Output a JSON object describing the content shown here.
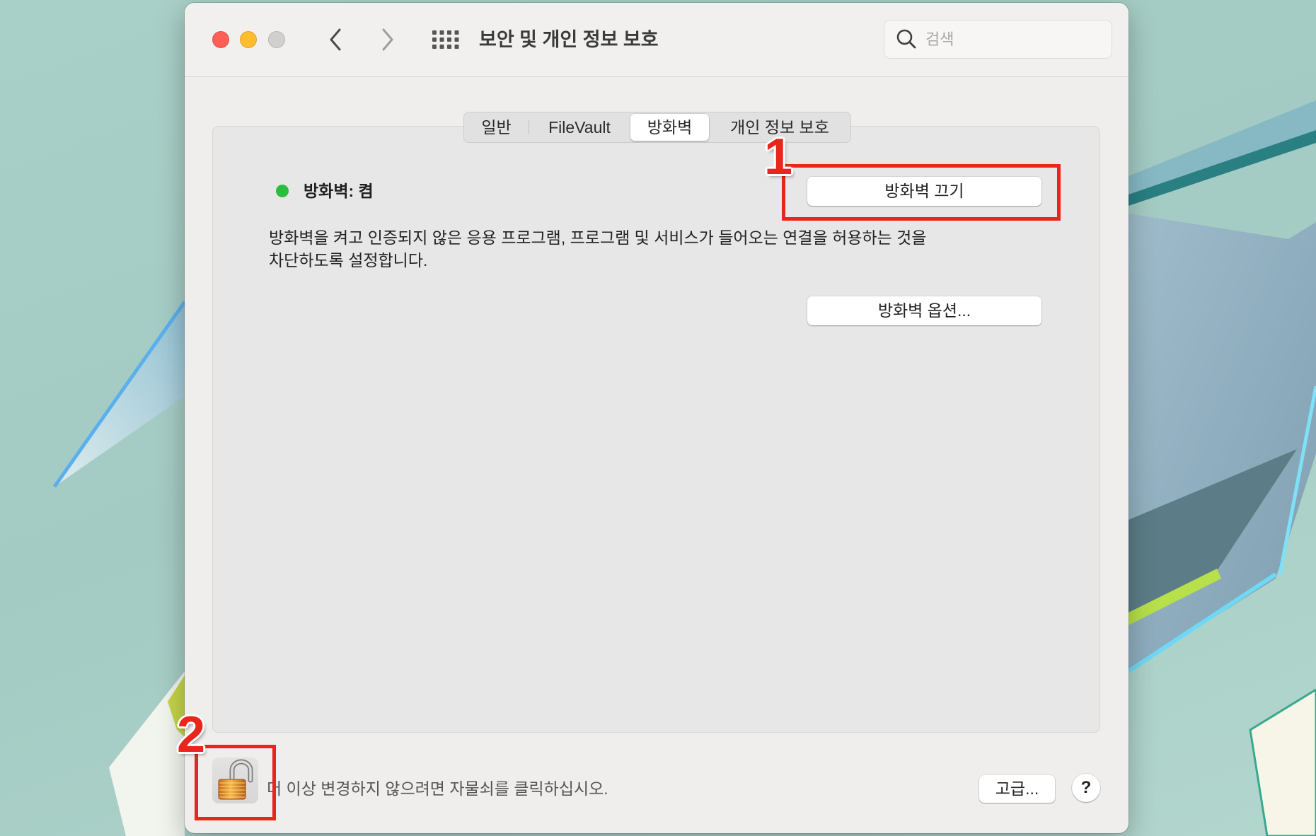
{
  "window": {
    "title": "보안 및 개인 정보 보호",
    "search_placeholder": "검색",
    "controls": {
      "close_color": "#ff5f57",
      "minimize_color": "#febc2e",
      "zoom_color": "#d0d0d0"
    }
  },
  "tabs": [
    {
      "label": "일반",
      "selected": false
    },
    {
      "label": "FileVault",
      "selected": false
    },
    {
      "label": "방화벽",
      "selected": true
    },
    {
      "label": "개인 정보 보호",
      "selected": false
    }
  ],
  "firewall": {
    "status_label": "방화벽: 켬",
    "status_color": "#2dbd3c",
    "toggle_button_label": "방화벽 끄기",
    "description_lines": [
      "방화벽을 켜고 인증되지 않은 응용 프로그램, 프로그램 및 서비스가 들어오는 연결을 허용하는 것을",
      "차단하도록 설정합니다."
    ],
    "options_button_label": "방화벽 옵션..."
  },
  "footer": {
    "lock_state_icon": "lock-open-icon",
    "lock_hint": "더 이상 변경하지 않으려면 자물쇠를 클릭하십시오.",
    "advanced_button_label": "고급...",
    "help_button_label": "?"
  },
  "annotations": [
    {
      "number": "1",
      "color": "#e8261b"
    },
    {
      "number": "2",
      "color": "#e8261b"
    }
  ]
}
